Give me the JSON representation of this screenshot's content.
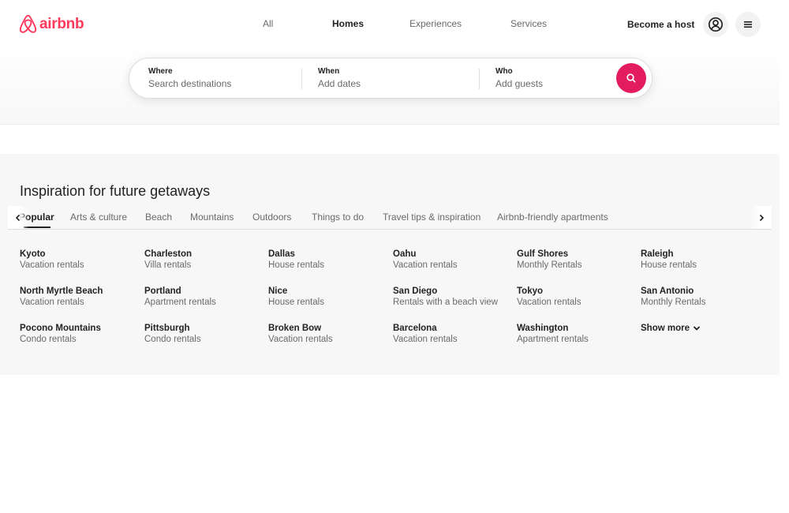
{
  "brand": {
    "name": "airbnb",
    "color": "#ff385c"
  },
  "nav": {
    "all": "All",
    "homes": "Homes",
    "experiences": "Experiences",
    "services": "Services",
    "active": "Homes"
  },
  "header": {
    "become_host": "Become a host",
    "profile_icon": "user-circle-icon",
    "menu_icon": "menu-icon"
  },
  "search": {
    "where_label": "Where",
    "where_value": "Search destinations",
    "when_label": "When",
    "when_value": "Add dates",
    "who_label": "Who",
    "who_value": "Add guests",
    "button_icon": "search-icon",
    "button_color": "#e31c5f"
  },
  "inspiration": {
    "title": "Inspiration for future getaways",
    "tabs": [
      "Popular",
      "Arts & culture",
      "Beach",
      "Mountains",
      "Outdoors",
      "Things to do",
      "Travel tips & inspiration",
      "Airbnb-friendly apartments"
    ],
    "active_tab": "Popular",
    "destinations": [
      {
        "city": "Kyoto",
        "type": "Vacation rentals"
      },
      {
        "city": "Charleston",
        "type": "Villa rentals"
      },
      {
        "city": "Dallas",
        "type": "House rentals"
      },
      {
        "city": "Oahu",
        "type": "Vacation rentals"
      },
      {
        "city": "Gulf Shores",
        "type": "Monthly Rentals"
      },
      {
        "city": "Raleigh",
        "type": "House rentals"
      },
      {
        "city": "North Myrtle Beach",
        "type": "Vacation rentals"
      },
      {
        "city": "Portland",
        "type": "Apartment rentals"
      },
      {
        "city": "Nice",
        "type": "House rentals"
      },
      {
        "city": "San Diego",
        "type": "Rentals with a beach view"
      },
      {
        "city": "Tokyo",
        "type": "Vacation rentals"
      },
      {
        "city": "San Antonio",
        "type": "Monthly Rentals"
      },
      {
        "city": "Pocono Mountains",
        "type": "Condo rentals"
      },
      {
        "city": "Pittsburgh",
        "type": "Condo rentals"
      },
      {
        "city": "Broken Bow",
        "type": "Vacation rentals"
      },
      {
        "city": "Barcelona",
        "type": "Vacation rentals"
      },
      {
        "city": "Washington",
        "type": "Apartment rentals"
      }
    ],
    "show_more": "Show more"
  }
}
